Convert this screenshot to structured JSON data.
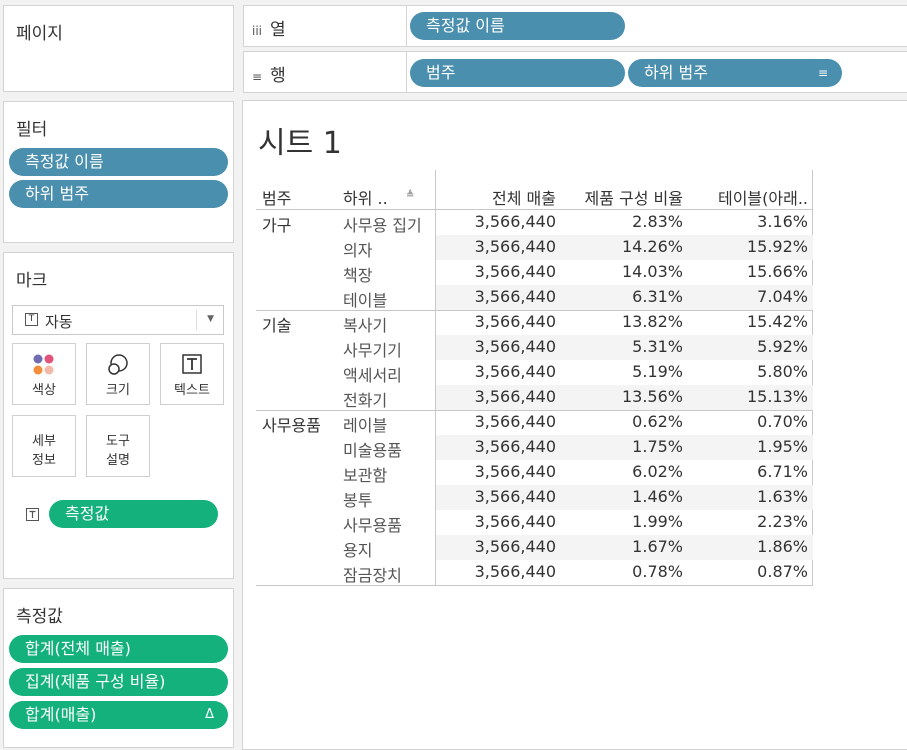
{
  "pages_panel": {
    "title": "페이지"
  },
  "columns_shelf": {
    "label": "열",
    "icon": "iii",
    "pills": [
      "측정값 이름"
    ]
  },
  "rows_shelf": {
    "label": "행",
    "icon": "≡",
    "pills": [
      "범주",
      "하위 범주"
    ],
    "sort_icon": "≡"
  },
  "filters_panel": {
    "title": "필터",
    "pills": [
      "측정값 이름",
      "하위 범주"
    ]
  },
  "marks_panel": {
    "title": "마크",
    "mark_type": "자동",
    "buttons": {
      "color": "색상",
      "size": "크기",
      "text": "텍스트",
      "detail_1": "세부",
      "detail_2": "정보",
      "tooltip_1": "도구",
      "tooltip_2": "설명"
    },
    "measure_pill": "측정값"
  },
  "measure_values_panel": {
    "title": "측정값",
    "pills": [
      "합계(전체 매출)",
      "집계(제품 구성 비율)",
      "합계(매출)"
    ],
    "delta_icon": "Δ"
  },
  "sheet": {
    "title": "시트 1"
  },
  "table": {
    "headers": [
      "범주",
      "하위 ..",
      "전체 매출",
      "제품 구성 비율",
      "테이블(아래.."
    ],
    "sort_icon": "≜",
    "groups": [
      {
        "category": "가구",
        "rows": [
          [
            "사무용 집기",
            "3,566,440",
            "2.83%",
            "3.16%"
          ],
          [
            "의자",
            "3,566,440",
            "14.26%",
            "15.92%"
          ],
          [
            "책장",
            "3,566,440",
            "14.03%",
            "15.66%"
          ],
          [
            "테이블",
            "3,566,440",
            "6.31%",
            "7.04%"
          ]
        ]
      },
      {
        "category": "기술",
        "rows": [
          [
            "복사기",
            "3,566,440",
            "13.82%",
            "15.42%"
          ],
          [
            "사무기기",
            "3,566,440",
            "5.31%",
            "5.92%"
          ],
          [
            "액세서리",
            "3,566,440",
            "5.19%",
            "5.80%"
          ],
          [
            "전화기",
            "3,566,440",
            "13.56%",
            "15.13%"
          ]
        ]
      },
      {
        "category": "사무용품",
        "rows": [
          [
            "레이블",
            "3,566,440",
            "0.62%",
            "0.70%"
          ],
          [
            "미술용품",
            "3,566,440",
            "1.75%",
            "1.95%"
          ],
          [
            "보관함",
            "3,566,440",
            "6.02%",
            "6.71%"
          ],
          [
            "봉투",
            "3,566,440",
            "1.46%",
            "1.63%"
          ],
          [
            "사무용품",
            "3,566,440",
            "1.99%",
            "2.23%"
          ],
          [
            "용지",
            "3,566,440",
            "1.67%",
            "1.86%"
          ],
          [
            "잠금장치",
            "3,566,440",
            "0.78%",
            "0.87%"
          ]
        ]
      }
    ]
  }
}
